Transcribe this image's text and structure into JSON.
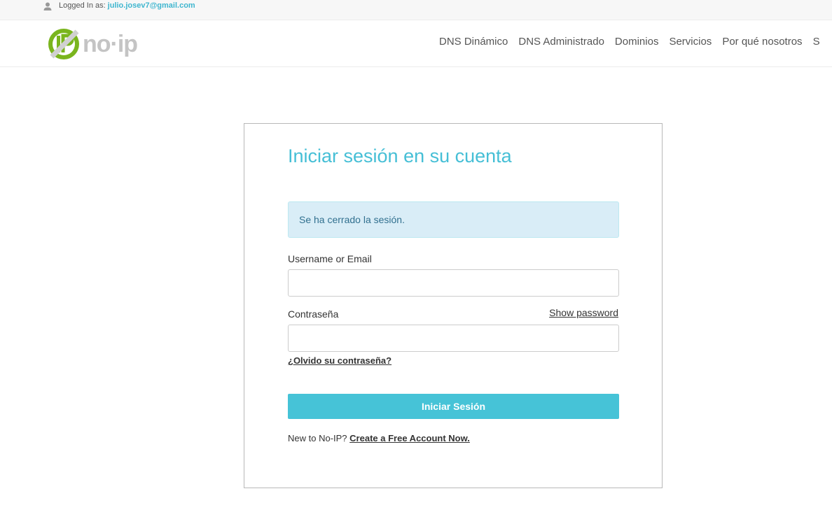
{
  "topbar": {
    "logged_in_label": "Logged In as:",
    "email": "julio.josev7@gmail.com",
    "icon": "user-icon"
  },
  "header": {
    "logo_text": "no·ip",
    "nav": [
      {
        "label": "DNS Dinámico"
      },
      {
        "label": "DNS Administrado"
      },
      {
        "label": "Dominios"
      },
      {
        "label": "Servicios"
      },
      {
        "label": "Por qué nosotros"
      },
      {
        "label": "S"
      }
    ]
  },
  "login": {
    "title": "Iniciar sesión en su cuenta",
    "alert": "Se ha cerrado la sesión.",
    "username_label": "Username or Email",
    "username_value": "",
    "password_label": "Contraseña",
    "password_value": "",
    "show_password": "Show password",
    "forgot": "¿Olvido su contraseña?",
    "submit": "Iniciar Sesión",
    "new_prefix": "New to No-IP?",
    "create_account": "Create a Free Account Now."
  },
  "colors": {
    "accent": "#46c3d7",
    "title": "#46bfd6",
    "alert_bg": "#d9edf7",
    "alert_text": "#31708f",
    "logo_green": "#7ab51d"
  }
}
